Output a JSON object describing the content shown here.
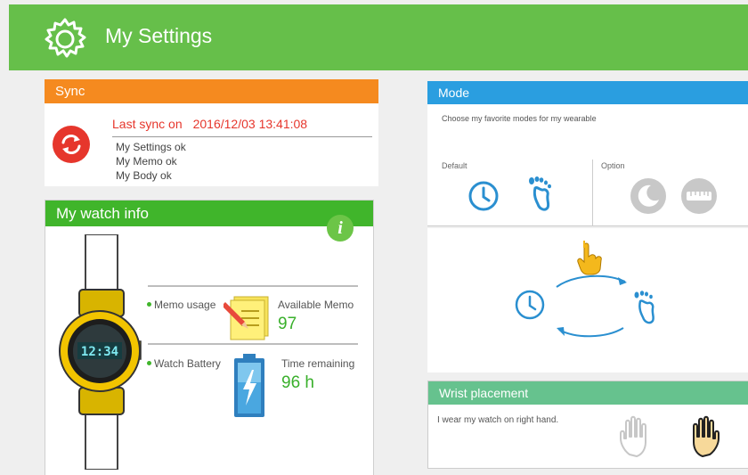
{
  "header": {
    "title": "My Settings",
    "icon": "gear-icon"
  },
  "sync": {
    "title": "Sync",
    "last_sync_label": "Last sync on",
    "last_sync_time": "2016/12/03 13:41:08",
    "lines": [
      "My Settings ok",
      "My Memo ok",
      "My Body ok"
    ]
  },
  "watch_info": {
    "title": "My watch info",
    "watch_time": "12:34",
    "memo_usage_label": "Memo usage",
    "available_memo_label": "Available Memo",
    "available_memo_value": "97",
    "battery_label": "Watch Battery",
    "time_remaining_label": "Time remaining",
    "time_remaining_value": "96 h"
  },
  "mode": {
    "title": "Mode",
    "description": "Choose my favorite modes for my wearable",
    "default_label": "Default",
    "option_label": "Option"
  },
  "wrist": {
    "title": "Wrist placement",
    "description": "I wear my watch on right hand."
  },
  "colors": {
    "header_green": "#66bf4a",
    "sync_orange": "#f58a1f",
    "watch_green": "#40b52b",
    "mode_blue": "#2a9ee0",
    "wrist_green": "#66c28e",
    "alert_red": "#e6362c"
  }
}
